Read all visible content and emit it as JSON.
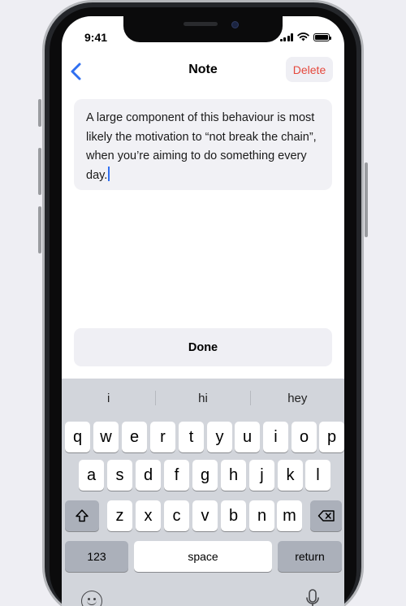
{
  "status_bar": {
    "time": "9:41"
  },
  "nav": {
    "title": "Note",
    "delete_label": "Delete"
  },
  "note": {
    "text": "A large component of this behaviour is most likely the motivation to “not break the chain”, when you’re aiming to do something every day."
  },
  "done_label": "Done",
  "keyboard": {
    "suggestions": [
      "i",
      "hi",
      "hey"
    ],
    "row1": [
      "q",
      "w",
      "e",
      "r",
      "t",
      "y",
      "u",
      "i",
      "o",
      "p"
    ],
    "row2": [
      "a",
      "s",
      "d",
      "f",
      "g",
      "h",
      "j",
      "k",
      "l"
    ],
    "row3": [
      "z",
      "x",
      "c",
      "v",
      "b",
      "n",
      "m"
    ],
    "numbers_label": "123",
    "space_label": "space",
    "return_label": "return"
  },
  "colors": {
    "accent": "#2f6ff0",
    "delete": "#e5483c",
    "keyboard_bg": "#d2d5db"
  }
}
